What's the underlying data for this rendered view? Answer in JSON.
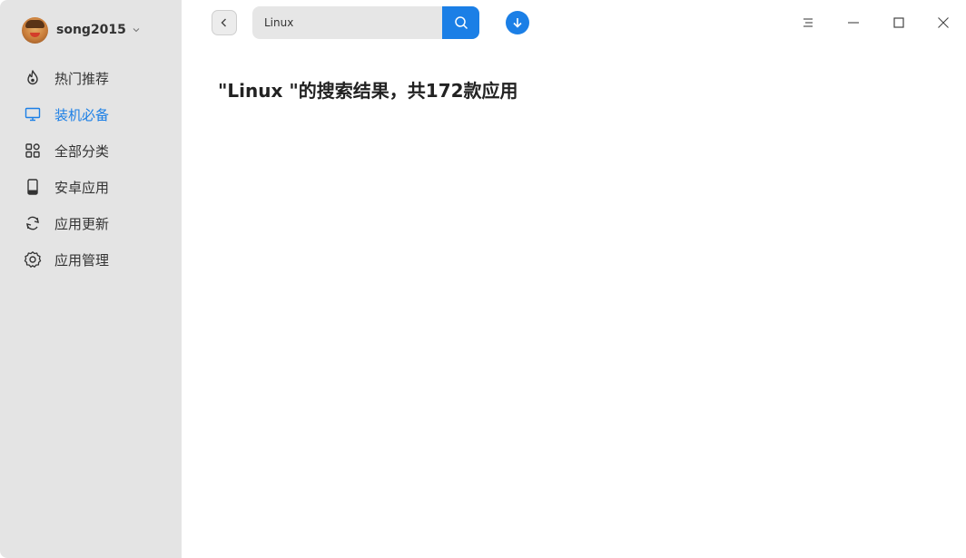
{
  "user": {
    "name": "song2015"
  },
  "sidebar": {
    "items": [
      {
        "label": "热门推荐",
        "icon": "hot-recommend-icon",
        "active": false
      },
      {
        "label": "装机必备",
        "icon": "monitor-icon",
        "active": true
      },
      {
        "label": "全部分类",
        "icon": "grid-categories-icon",
        "active": false
      },
      {
        "label": "安卓应用",
        "icon": "phone-icon",
        "active": false
      },
      {
        "label": "应用更新",
        "icon": "refresh-icon",
        "active": false
      },
      {
        "label": "应用管理",
        "icon": "gear-icon",
        "active": false
      }
    ]
  },
  "search": {
    "value": "Linux"
  },
  "main": {
    "result_title": "\"Linux \"的搜索结果，共172款应用"
  },
  "colors": {
    "accent": "#1b7fe6",
    "sidebar_bg": "#e4e4e4",
    "text": "#333333"
  }
}
